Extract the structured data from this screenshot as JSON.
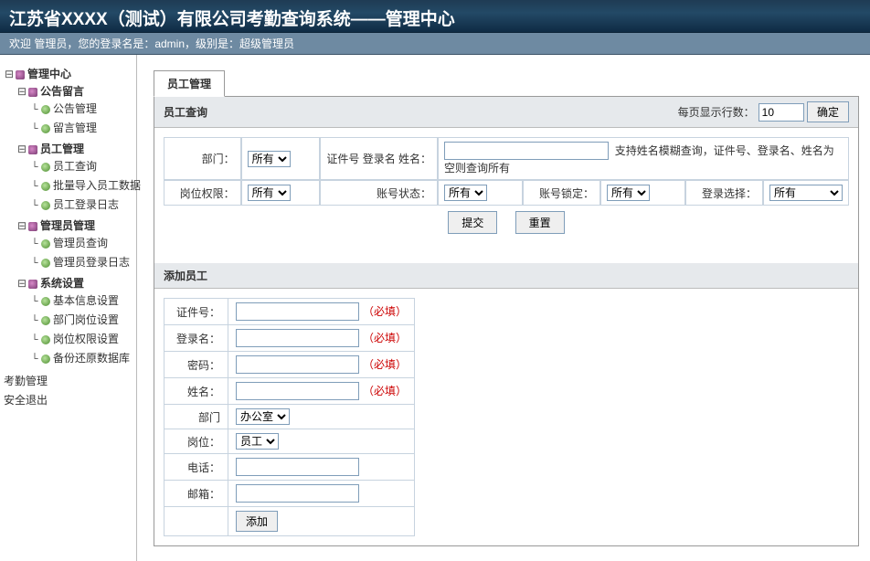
{
  "header": {
    "title": "江苏省XXXX（测试）有限公司考勤查询系统——管理中心",
    "welcome": "欢迎 管理员，您的登录名是：admin，级别是：超级管理员"
  },
  "sidebar": {
    "root": "管理中心",
    "groups": [
      {
        "label": "公告留言",
        "items": [
          "公告管理",
          "留言管理"
        ]
      },
      {
        "label": "员工管理",
        "items": [
          "员工查询",
          "批量导入员工数据",
          "员工登录日志"
        ]
      },
      {
        "label": "管理员管理",
        "items": [
          "管理员查询",
          "管理员登录日志"
        ]
      },
      {
        "label": "系统设置",
        "items": [
          "基本信息设置",
          "部门岗位设置",
          "岗位权限设置",
          "备份还原数据库"
        ]
      }
    ],
    "rootItems": [
      "考勤管理",
      "安全退出"
    ]
  },
  "tabs": {
    "active": "员工管理"
  },
  "search": {
    "heading": "员工查询",
    "rowsPerPageLabel": "每页显示行数：",
    "rowsPerPage": "10",
    "confirm": "确定",
    "fields": {
      "dept": "部门：",
      "idname": "证件号 登录名 姓名：",
      "role": "岗位权限：",
      "accStatus": "账号状态：",
      "accLock": "账号锁定：",
      "loginSel": "登录选择："
    },
    "options": {
      "all": "所有"
    },
    "hint": "支持姓名模糊查询，证件号、登录名、姓名为空则查询所有",
    "submit": "提交",
    "reset": "重置"
  },
  "add": {
    "heading": "添加员工",
    "fields": {
      "id": "证件号：",
      "login": "登录名：",
      "pwd": "密码：",
      "name": "姓名：",
      "dept": "部门",
      "position": "岗位：",
      "phone": "电话：",
      "email": "邮箱："
    },
    "required": "（必填）",
    "deptOption": "办公室",
    "positionOption": "员工",
    "addBtn": "添加"
  }
}
